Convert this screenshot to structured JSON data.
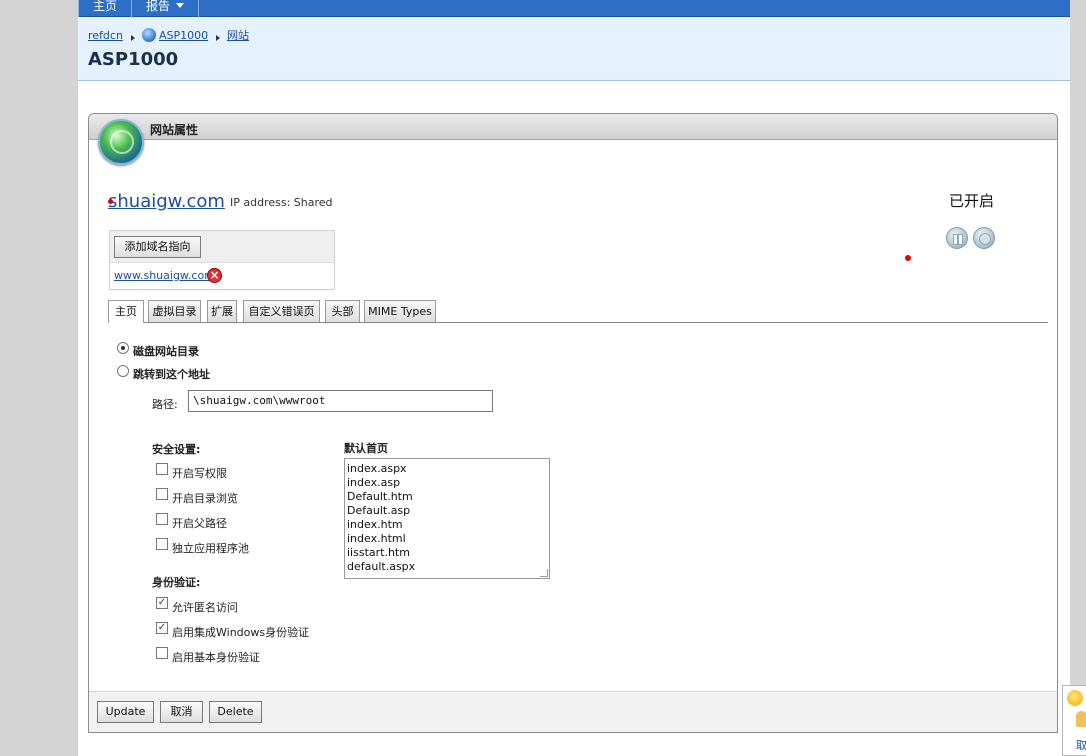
{
  "nav": {
    "home": "主页",
    "report": "报告"
  },
  "breadcrumb": {
    "item1": "refdcn",
    "item2": "ASP1000",
    "item3": "网站"
  },
  "page_title": "ASP1000",
  "panel": {
    "title": "网站属性"
  },
  "site": {
    "name": "shuaigw.com",
    "ip": "IP address: Shared",
    "status": "已开启",
    "add_domain": "添加域名指向",
    "domain": "www.shuaigw.com",
    "delete_icon": "×"
  },
  "tabs": [
    "主页",
    "虚拟目录",
    "扩展",
    "自定义错误页",
    "头部",
    "MIME Types"
  ],
  "home": {
    "radio_disk": "磁盘网站目录",
    "radio_redirect": "跳转到这个地址",
    "path_label": "路径:",
    "path_value": "\\shuaigw.com\\wwwroot",
    "security_title": "安全设置:",
    "security": [
      {
        "label": "开启写权限",
        "checked": false
      },
      {
        "label": "开启目录浏览",
        "checked": false
      },
      {
        "label": "开启父路径",
        "checked": false
      },
      {
        "label": "独立应用程序池",
        "checked": false
      }
    ],
    "auth_title": "身份验证:",
    "auth": [
      {
        "label": "允许匿名访问",
        "checked": true
      },
      {
        "label": "启用集成Windows身份验证",
        "checked": true
      },
      {
        "label": "启用基本身份验证",
        "checked": false
      }
    ],
    "default_title": "默认首页",
    "default_docs": "index.aspx\nindex.asp\nDefault.htm\nDefault.asp\nindex.htm\nindex.html\niisstart.htm\ndefault.aspx"
  },
  "footer": {
    "update": "Update",
    "cancel": "取消",
    "delete": "Delete"
  },
  "widget": {
    "text": "取"
  },
  "colors": {
    "nav_bg": "#2d6fc6",
    "header_bg": "#e5f1fc",
    "link": "#1a4ea0"
  }
}
